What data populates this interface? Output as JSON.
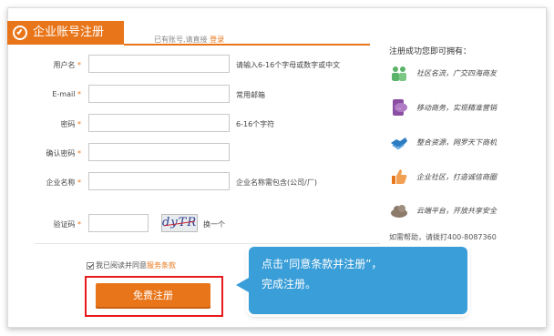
{
  "header": {
    "tab_label": "企业账号注册",
    "hint_text": "已有账号,请直接",
    "login_link": "登录"
  },
  "form": {
    "fields": [
      {
        "label": "用户名",
        "required": "*",
        "tip": "请输入6-16个字母或数字或中文",
        "value": ""
      },
      {
        "label": "E-mail",
        "required": "*",
        "tip": "常用邮箱",
        "value": ""
      },
      {
        "label": "密码",
        "required": "*",
        "tip": "6-16个字符",
        "value": ""
      },
      {
        "label": "确认密码",
        "required": "*",
        "tip": "",
        "value": ""
      },
      {
        "label": "企业名称",
        "required": "*",
        "tip": "企业名称需包含(公司/厂)",
        "value": ""
      }
    ],
    "captcha": {
      "label": "验证码",
      "required": "*",
      "value": "",
      "image_text": "dyTR",
      "refresh_label": "换一个"
    },
    "agree_text": "我已阅读并同意",
    "terms_link": "服务条款",
    "submit_label": "免费注册"
  },
  "callout": {
    "line1": "点击“同意条款并注册”，",
    "line2": "完成注册。"
  },
  "sidebar": {
    "title": "注册成功您即可拥有：",
    "features": [
      {
        "icon": "community-icon",
        "text": "社区名流，广交四海商友",
        "color": "#5bb36a"
      },
      {
        "icon": "mobile-business-icon",
        "text": "移动商务，实现精准营销",
        "color": "#8a4fa3"
      },
      {
        "icon": "shake-hands-icon",
        "text": "整合资源，网罗天下商机",
        "color": "#2b7cc1"
      },
      {
        "icon": "thumbs-up-icon",
        "text": "企业社区，打造诚信商圈",
        "color": "#e8751a"
      },
      {
        "icon": "cloud-icon",
        "text": "云端平台，开放共享安全",
        "color": "#8c7b6b"
      }
    ],
    "help_text": "如需帮助，请拨打400-8087360"
  }
}
